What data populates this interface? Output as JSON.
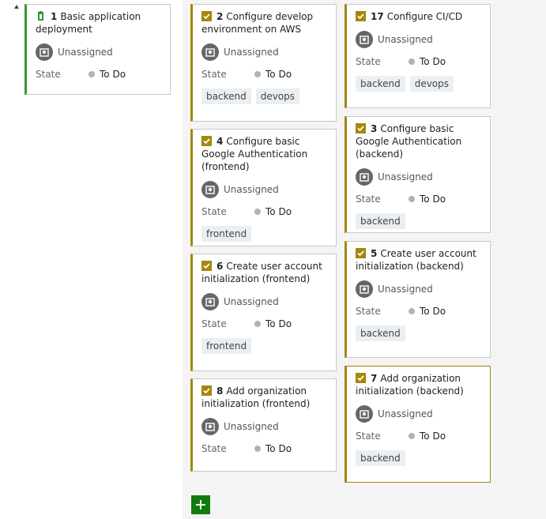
{
  "colors": {
    "parent_accent": "#339933",
    "task_accent": "#a4880a",
    "add_button": "#107c10",
    "lane_background": "#f4f4f4"
  },
  "icons": {
    "collapse": "collapse-triangle-icon",
    "parent": "parent-work-item-icon",
    "task": "task-checkbox-icon",
    "avatar": "user-avatar-icon",
    "add": "plus-icon"
  },
  "parent_card": {
    "id": "1",
    "title": "Basic application deployment",
    "assignee": "Unassigned",
    "state_label": "State",
    "state_value": "To Do"
  },
  "cards": [
    {
      "id": "2",
      "title": "Configure develop environment on AWS",
      "assignee": "Unassigned",
      "state_label": "State",
      "state_value": "To Do",
      "tags": [
        "backend",
        "devops"
      ]
    },
    {
      "id": "17",
      "title": "Configure CI/CD",
      "assignee": "Unassigned",
      "state_label": "State",
      "state_value": "To Do",
      "tags": [
        "backend",
        "devops"
      ]
    },
    {
      "id": "4",
      "title": "Configure basic Google Authentication (frontend)",
      "assignee": "Unassigned",
      "state_label": "State",
      "state_value": "To Do",
      "tags": [
        "frontend"
      ]
    },
    {
      "id": "3",
      "title": "Configure basic Google Authentication (backend)",
      "assignee": "Unassigned",
      "state_label": "State",
      "state_value": "To Do",
      "tags": [
        "backend"
      ]
    },
    {
      "id": "6",
      "title": "Create user account initialization (frontend)",
      "assignee": "Unassigned",
      "state_label": "State",
      "state_value": "To Do",
      "tags": [
        "frontend"
      ]
    },
    {
      "id": "5",
      "title": "Create user account initialization (backend)",
      "assignee": "Unassigned",
      "state_label": "State",
      "state_value": "To Do",
      "tags": [
        "backend"
      ]
    },
    {
      "id": "8",
      "title": "Add organization initialization (frontend)",
      "assignee": "Unassigned",
      "state_label": "State",
      "state_value": "To Do",
      "tags": []
    },
    {
      "id": "7",
      "title": "Add organization initialization (backend)",
      "assignee": "Unassigned",
      "state_label": "State",
      "state_value": "To Do",
      "tags": [
        "backend"
      ]
    }
  ]
}
